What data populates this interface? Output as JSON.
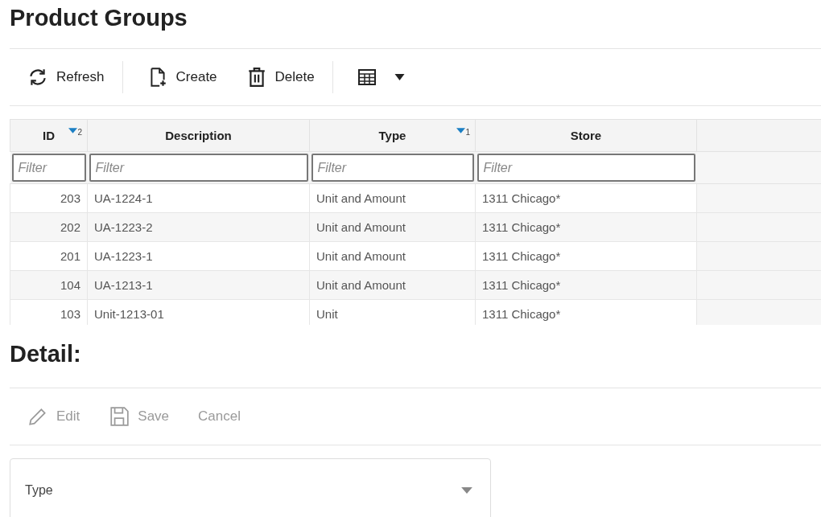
{
  "title": "Product Groups",
  "toolbar": [
    {
      "kind": "refresh",
      "label": "Refresh",
      "disabled": false
    },
    {
      "kind": "create",
      "label": "Create",
      "disabled": false
    },
    {
      "kind": "delete",
      "label": "Delete",
      "disabled": false
    },
    {
      "kind": "columns",
      "disabled": false
    }
  ],
  "table": {
    "columns": [
      {
        "label": "ID",
        "sort": {
          "order": "2"
        },
        "filter_placeholder": "Filter"
      },
      {
        "label": "Description",
        "filter_placeholder": "Filter"
      },
      {
        "label": "Type",
        "sort": {
          "order": "1"
        },
        "filter_placeholder": "Filter"
      },
      {
        "label": "Store",
        "filter_placeholder": "Filter"
      }
    ],
    "rows": [
      [
        "203",
        "UA-1224-1",
        "Unit and Amount",
        "1311 Chicago*"
      ],
      [
        "202",
        "UA-1223-2",
        "Unit and Amount",
        "1311 Chicago*"
      ],
      [
        "201",
        "UA-1223-1",
        "Unit and Amount",
        "1311 Chicago*"
      ],
      [
        "104",
        "UA-1213-1",
        "Unit and Amount",
        "1311 Chicago*"
      ],
      [
        "103",
        "Unit-1213-01",
        "Unit",
        "1311 Chicago*"
      ]
    ]
  },
  "detail": {
    "title": "Detail:",
    "toolbar": [
      {
        "kind": "edit",
        "label": "Edit",
        "disabled": true
      },
      {
        "kind": "save",
        "label": "Save",
        "disabled": true
      },
      {
        "kind": "cancel",
        "label": "Cancel",
        "disabled": true
      }
    ],
    "type_select": {
      "label": "Type"
    }
  }
}
